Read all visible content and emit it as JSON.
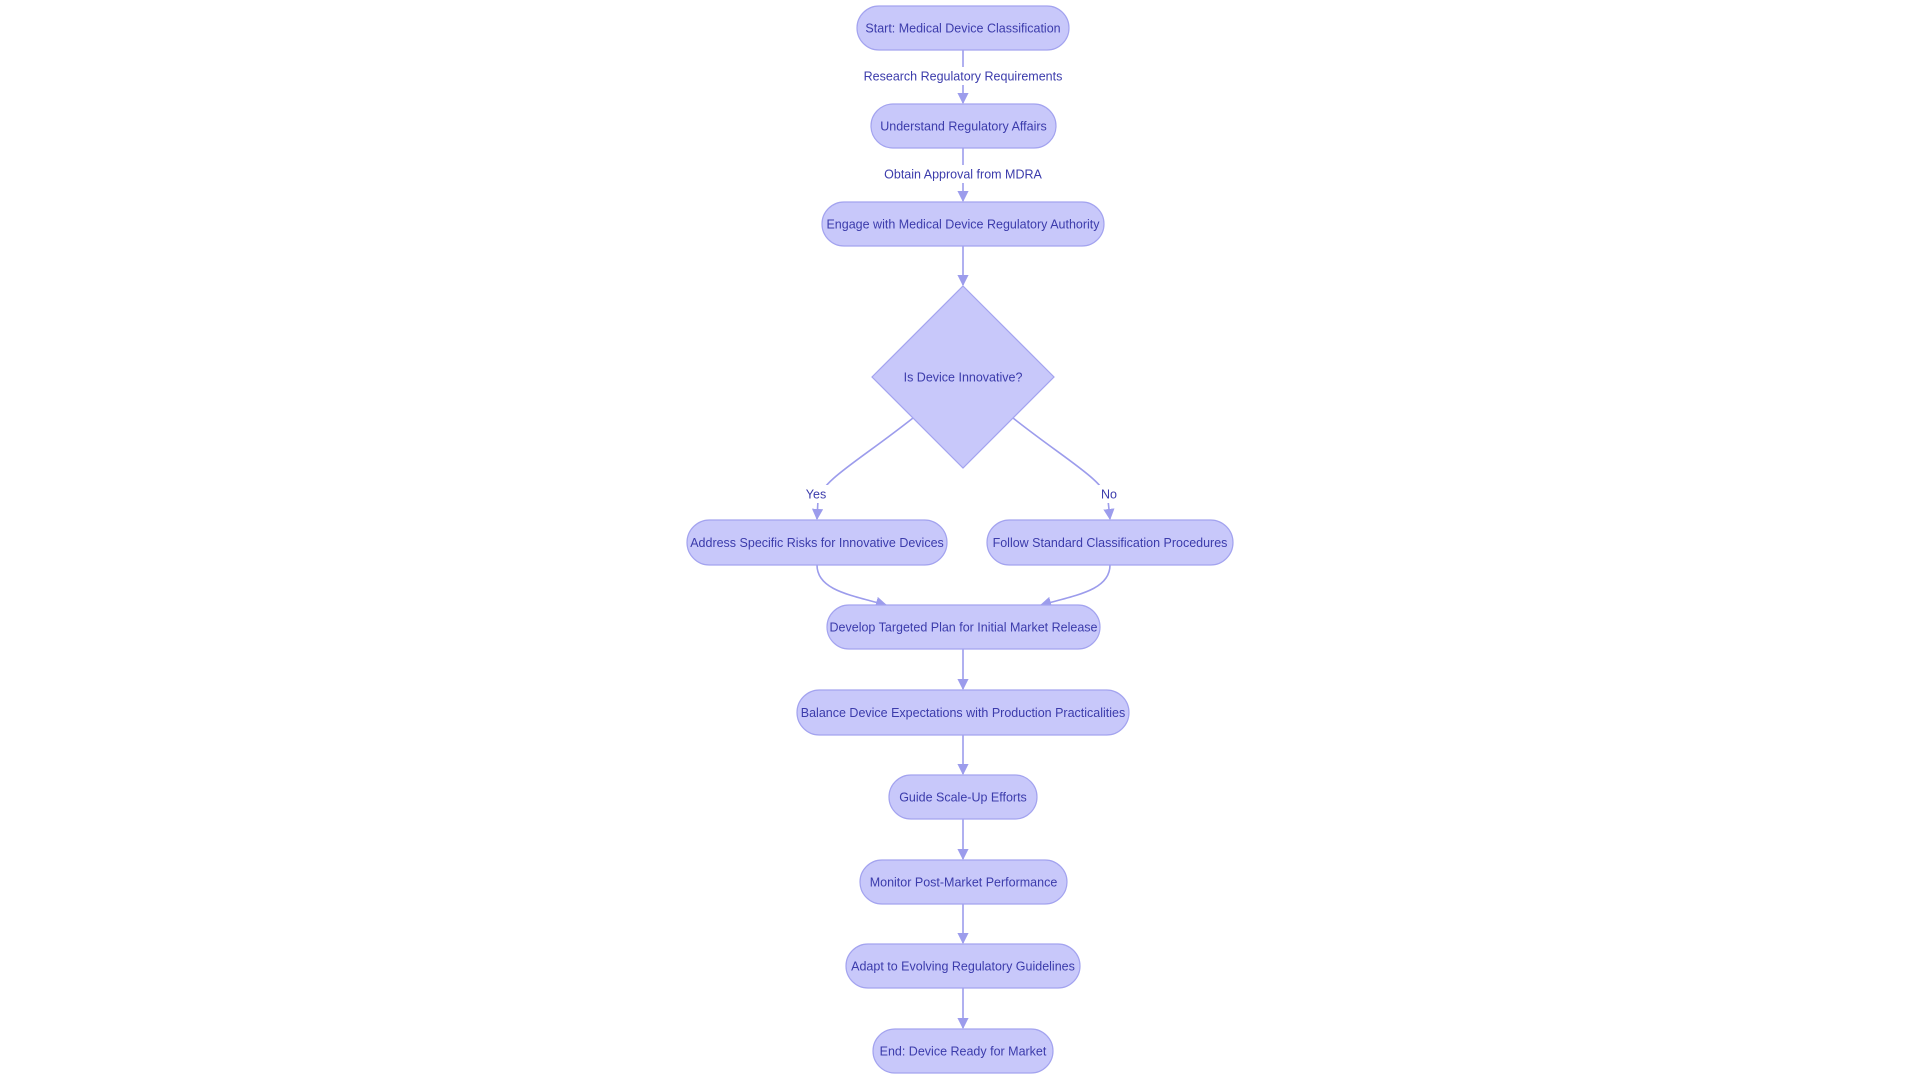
{
  "diagram": {
    "type": "flowchart",
    "colors": {
      "node_fill": "#c8c8fa",
      "node_stroke": "#a3a3ef",
      "text": "#3b3bab",
      "edge": "#9c9cec"
    },
    "nodes": [
      {
        "id": "start",
        "label": "Start: Medical Device Classification",
        "shape": "stadium"
      },
      {
        "id": "understand",
        "label": "Understand Regulatory Affairs",
        "shape": "stadium"
      },
      {
        "id": "engage",
        "label": "Engage with Medical Device Regulatory Authority",
        "shape": "stadium"
      },
      {
        "id": "innovative",
        "label": "Is Device Innovative?",
        "shape": "diamond"
      },
      {
        "id": "address",
        "label": "Address Specific Risks for Innovative Devices",
        "shape": "stadium"
      },
      {
        "id": "follow",
        "label": "Follow Standard Classification Procedures",
        "shape": "stadium"
      },
      {
        "id": "develop",
        "label": "Develop Targeted Plan for Initial Market Release",
        "shape": "stadium"
      },
      {
        "id": "balance",
        "label": "Balance Device Expectations with Production Practicalities",
        "shape": "stadium"
      },
      {
        "id": "guide",
        "label": "Guide Scale-Up Efforts",
        "shape": "stadium"
      },
      {
        "id": "monitor",
        "label": "Monitor Post-Market Performance",
        "shape": "stadium"
      },
      {
        "id": "adapt",
        "label": "Adapt to Evolving Regulatory Guidelines",
        "shape": "stadium"
      },
      {
        "id": "end",
        "label": "End: Device Ready for Market",
        "shape": "stadium"
      }
    ],
    "edges": [
      {
        "from": "start",
        "to": "understand",
        "label": "Research Regulatory Requirements"
      },
      {
        "from": "understand",
        "to": "engage",
        "label": "Obtain Approval from MDRA"
      },
      {
        "from": "engage",
        "to": "innovative",
        "label": ""
      },
      {
        "from": "innovative",
        "to": "address",
        "label": "Yes"
      },
      {
        "from": "innovative",
        "to": "follow",
        "label": "No"
      },
      {
        "from": "address",
        "to": "develop",
        "label": ""
      },
      {
        "from": "follow",
        "to": "develop",
        "label": ""
      },
      {
        "from": "develop",
        "to": "balance",
        "label": ""
      },
      {
        "from": "balance",
        "to": "guide",
        "label": ""
      },
      {
        "from": "guide",
        "to": "monitor",
        "label": ""
      },
      {
        "from": "monitor",
        "to": "adapt",
        "label": ""
      },
      {
        "from": "adapt",
        "to": "end",
        "label": ""
      }
    ]
  }
}
